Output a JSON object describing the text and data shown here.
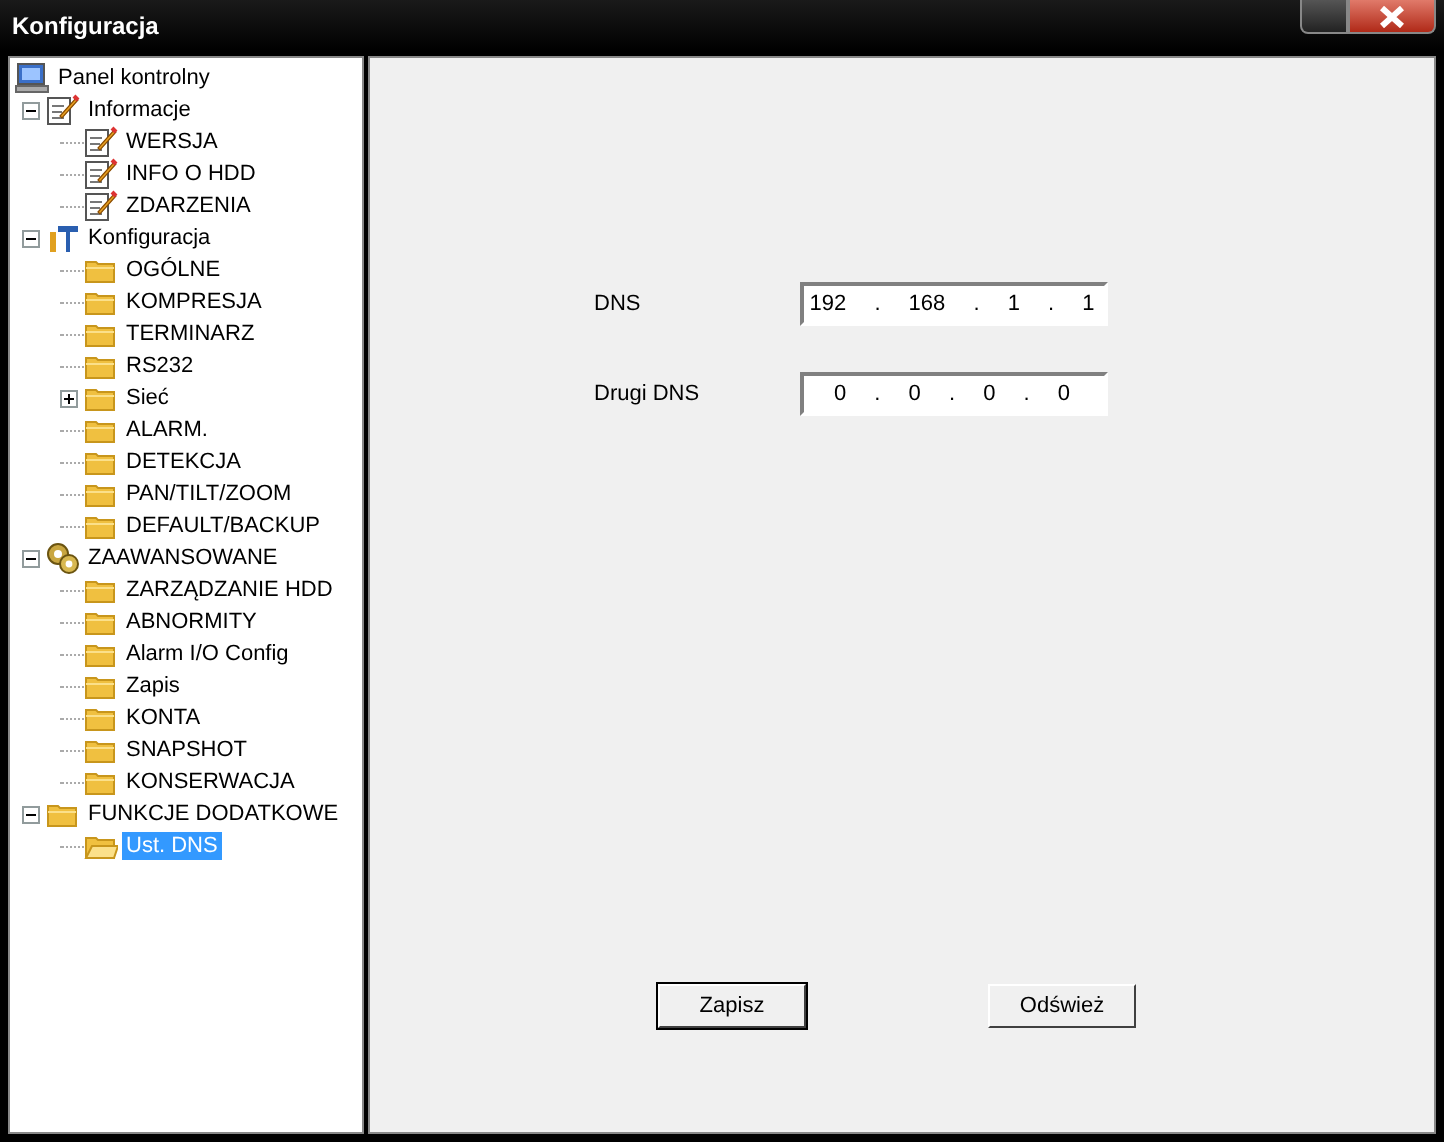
{
  "window": {
    "title": "Konfiguracja"
  },
  "tree": [
    {
      "label": "Panel kontrolny",
      "kind": "computer",
      "selected": false
    },
    {
      "label": "Informacje",
      "kind": "notes",
      "expanded": true,
      "selected": false,
      "children": [
        {
          "label": "WERSJA",
          "kind": "notes",
          "selected": false
        },
        {
          "label": "INFO O HDD",
          "kind": "notes",
          "selected": false
        },
        {
          "label": "ZDARZENIA",
          "kind": "notes",
          "selected": false
        }
      ]
    },
    {
      "label": "Konfiguracja",
      "kind": "tools",
      "expanded": true,
      "selected": false,
      "children": [
        {
          "label": "OGÓLNE",
          "kind": "folder",
          "selected": false
        },
        {
          "label": "KOMPRESJA",
          "kind": "folder",
          "selected": false
        },
        {
          "label": "TERMINARZ",
          "kind": "folder",
          "selected": false
        },
        {
          "label": "RS232",
          "kind": "folder",
          "selected": false
        },
        {
          "label": "Sieć",
          "kind": "folder",
          "expanded": false,
          "selected": false
        },
        {
          "label": "ALARM.",
          "kind": "folder",
          "selected": false
        },
        {
          "label": "DETEKCJA",
          "kind": "folder",
          "selected": false
        },
        {
          "label": "PAN/TILT/ZOOM",
          "kind": "folder",
          "selected": false
        },
        {
          "label": "DEFAULT/BACKUP",
          "kind": "folder",
          "selected": false
        }
      ]
    },
    {
      "label": "ZAAWANSOWANE",
      "kind": "gears",
      "expanded": true,
      "selected": false,
      "children": [
        {
          "label": "ZARZĄDZANIE HDD",
          "kind": "folder",
          "selected": false
        },
        {
          "label": "ABNORMITY",
          "kind": "folder",
          "selected": false
        },
        {
          "label": "Alarm I/O Config",
          "kind": "folder",
          "selected": false
        },
        {
          "label": "Zapis",
          "kind": "folder",
          "selected": false
        },
        {
          "label": "KONTA",
          "kind": "folder",
          "selected": false
        },
        {
          "label": "SNAPSHOT",
          "kind": "folder",
          "selected": false
        },
        {
          "label": "KONSERWACJA",
          "kind": "folder",
          "selected": false
        }
      ]
    },
    {
      "label": "FUNKCJE DODATKOWE",
      "kind": "folder",
      "expanded": true,
      "selected": false,
      "children": [
        {
          "label": "Ust. DNS",
          "kind": "folder",
          "selected": true
        }
      ]
    }
  ],
  "fields": [
    {
      "label": "DNS",
      "value": "192 . 168 . 1 . 1"
    },
    {
      "label": "Drugi DNS",
      "value": "0 . 0 . 0 . 0"
    }
  ],
  "buttons": [
    {
      "label": "Zapisz",
      "focused": true
    },
    {
      "label": "Odśwież",
      "focused": false
    }
  ]
}
